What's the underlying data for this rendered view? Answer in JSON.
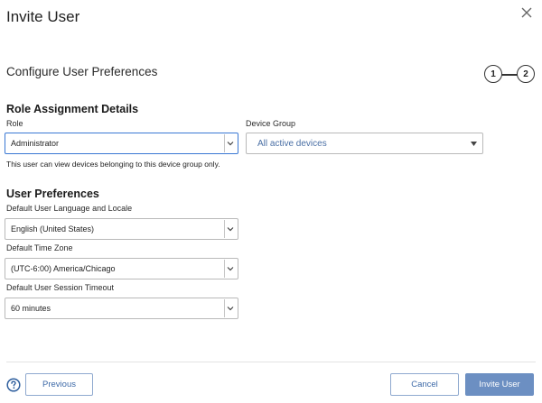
{
  "dialog": {
    "title": "Invite User",
    "subtitle": "Configure User Preferences"
  },
  "steps": [
    "1",
    "2"
  ],
  "role_section": {
    "heading": "Role Assignment Details",
    "role_label": "Role",
    "role_value": "Administrator",
    "device_group_label": "Device Group",
    "device_group_value": "All active devices",
    "helper_text": "This user can view devices belonging to this device group only."
  },
  "preferences_section": {
    "heading": "User Preferences",
    "language_label": "Default User Language and Locale",
    "language_value": "English (United States)",
    "timezone_label": "Default Time Zone",
    "timezone_value": "(UTC-6:00) America/Chicago",
    "timeout_label": "Default User Session Timeout",
    "timeout_value": "60 minutes"
  },
  "footer": {
    "previous_label": "Previous",
    "cancel_label": "Cancel",
    "invite_label": "Invite User"
  },
  "icons": {
    "close": "close-icon",
    "help": "help-icon",
    "chevron": "chevron-down-icon"
  },
  "colors": {
    "primary": "#6c8fc2",
    "link": "#3e6aa8",
    "focus_border": "#3a78d4"
  }
}
